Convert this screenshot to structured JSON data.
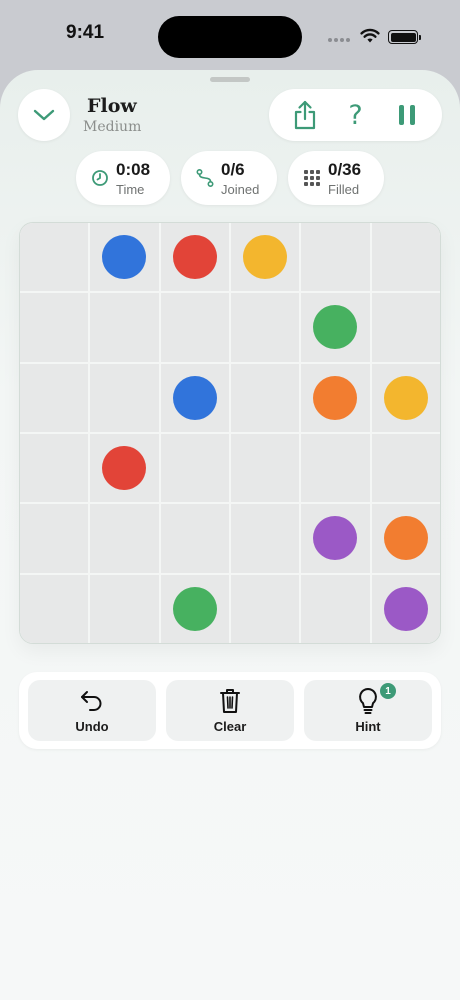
{
  "status_bar": {
    "time": "9:41"
  },
  "header": {
    "title": "Flow",
    "subtitle": "Medium",
    "actions": [
      "share-icon",
      "help-icon",
      "pause-icon"
    ],
    "help_glyph": "?"
  },
  "stats": [
    {
      "icon": "clock-icon",
      "value": "0:08",
      "label": "Time"
    },
    {
      "icon": "path-icon",
      "value": "0/6",
      "label": "Joined"
    },
    {
      "icon": "grid-icon",
      "value": "0/36",
      "label": "Filled"
    }
  ],
  "board": {
    "rows": 6,
    "cols": 6,
    "colors": {
      "blue": "#3174db",
      "red": "#e24438",
      "yellow": "#f3b62e",
      "green": "#47b160",
      "orange": "#f27d30",
      "purple": "#9b59c6"
    },
    "cells": [
      [
        "",
        "blue",
        "red",
        "yellow",
        "",
        ""
      ],
      [
        "",
        "",
        "",
        "",
        "green",
        ""
      ],
      [
        "",
        "",
        "blue",
        "",
        "orange",
        "yellow"
      ],
      [
        "",
        "red",
        "",
        "",
        "",
        ""
      ],
      [
        "",
        "",
        "",
        "",
        "purple",
        "orange"
      ],
      [
        "",
        "",
        "green",
        "",
        "",
        "purple"
      ]
    ]
  },
  "controls": {
    "undo_label": "Undo",
    "clear_label": "Clear",
    "hint_label": "Hint",
    "hint_badge": "1"
  },
  "accent_color": "#3d9a77"
}
